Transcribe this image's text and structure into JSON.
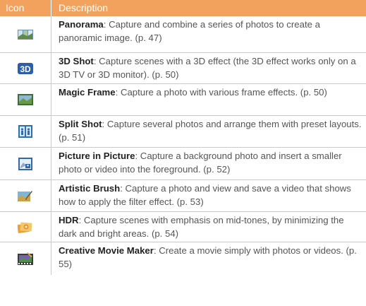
{
  "header": {
    "icon_col": "Icon",
    "desc_col": "Description"
  },
  "rows": [
    {
      "name": "Panorama",
      "desc": ": Capture and combine a series of photos to create a panoramic image. (p. 47)",
      "icon": "panorama-icon"
    },
    {
      "name": "3D Shot",
      "desc": ": Capture scenes with a 3D effect (the 3D effect works only on a 3D TV or 3D monitor). (p. 50)",
      "icon": "3d-shot-icon"
    },
    {
      "name": "Magic Frame",
      "desc": ": Capture a photo with various frame effects. (p. 50)",
      "icon": "magic-frame-icon"
    },
    {
      "name": "Split Shot",
      "desc": ": Capture several photos and arrange them with preset layouts. (p. 51)",
      "icon": "split-shot-icon"
    },
    {
      "name": "Picture in Picture",
      "desc": ": Capture a background photo and insert a smaller photo or video into the foreground. (p. 52)",
      "icon": "picture-in-picture-icon"
    },
    {
      "name": "Artistic Brush",
      "desc": ": Capture a photo and view and save a video that shows how to apply the filter effect. (p. 53)",
      "icon": "artistic-brush-icon"
    },
    {
      "name": "HDR",
      "desc": ": Capture scenes with emphasis on mid-tones, by minimizing the dark and bright areas. (p. 54)",
      "icon": "hdr-icon"
    },
    {
      "name": "Creative Movie Maker",
      "desc": ": Create a movie simply with photos or videos. (p. 55)",
      "icon": "creative-movie-maker-icon"
    }
  ],
  "colors": {
    "header_bg": "#f2a25c",
    "border": "#c9c9c9"
  }
}
